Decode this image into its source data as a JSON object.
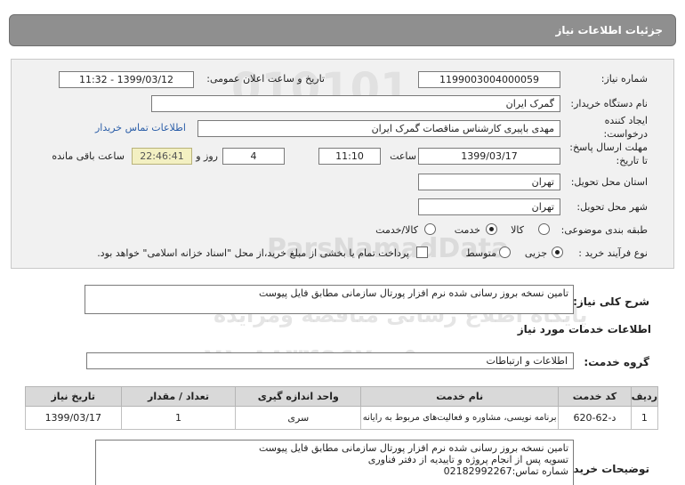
{
  "header": {
    "title": "جزئیات اطلاعات نیاز"
  },
  "form": {
    "need_number": {
      "label": "شماره نیاز:",
      "value": "1199003004000059"
    },
    "announce_datetime": {
      "label": "تاریخ و ساعت اعلان عمومی:",
      "value": "1399/03/12 - 11:32"
    },
    "buyer_org": {
      "label": "نام دستگاه خریدار:",
      "value": "گمرک ایران"
    },
    "requester": {
      "label_line1": "ایجاد کننده",
      "label_line2": "درخواست:",
      "value": "مهدی باپیری کارشناس مناقصات گمرک ایران"
    },
    "contact_link": "اطلاعات تماس خریدار",
    "deadline": {
      "label_line1": "مهلت ارسال پاسخ:",
      "label_line2": "تا تاریخ:",
      "date": "1399/03/17",
      "time_label": "ساعت",
      "time": "11:10",
      "days": "4",
      "days_label": "روز و",
      "remaining": "22:46:41",
      "remaining_label": "ساعت باقی مانده"
    },
    "province": {
      "label": "استان محل تحویل:",
      "value": "تهران"
    },
    "city": {
      "label": "شهر محل تحویل:",
      "value": "تهران"
    },
    "category": {
      "label": "طبقه بندی موضوعی:",
      "options": [
        "کالا",
        "خدمت",
        "کالا/خدمت"
      ],
      "selected": "خدمت"
    },
    "purchase_process": {
      "label": "نوع فرآیند خرید :",
      "options": [
        "جزیی",
        "متوسط"
      ],
      "selected": "جزیی",
      "payment_note": "پرداخت تمام یا بخشی از مبلغ خرید،از محل \"اسناد خزانه اسلامی\" خواهد بود."
    }
  },
  "summary": {
    "label": "شرح کلی نیاز:",
    "value": "تامین نسخه بروز رسانی شده نرم افزار پورتال سازمانی مطابق فایل پیوست"
  },
  "services_section": {
    "title": "اطلاعات خدمات مورد نیاز"
  },
  "service_group": {
    "label": "گروه خدمت:",
    "value": "اطلاعات و ارتباطات"
  },
  "table": {
    "headers": [
      "ردیف",
      "کد خدمت",
      "نام خدمت",
      "واحد اندازه گیری",
      "تعداد / مقدار",
      "تاریخ نیاز"
    ],
    "rows": [
      [
        "1",
        "د-62-620",
        "برنامه نویسی، مشاوره و فعالیت‌های مربوط به رایانه",
        "سری",
        "1",
        "1399/03/17"
      ]
    ]
  },
  "buyer_notes": {
    "label": "توضیحات خریدار:",
    "lines": [
      "تامین نسخه بروز رسانی شده نرم افزار پورتال سازمانی مطابق فایل پیوست",
      "تسویه پس از انجام پروژه و تاییدیه از دفتر فناوری",
      "شماره تماس:02182992267"
    ]
  },
  "watermark": {
    "line1": "ParsNamadData",
    "line2": "پایگاه اطلاع رسانی مناقصه ومزایده",
    "line3": "۰۲۱-۸۸۳۴۹۶۷۰-۵",
    "line4": "مرکز فراوری اطلاعات پارس نماد داده ها"
  }
}
